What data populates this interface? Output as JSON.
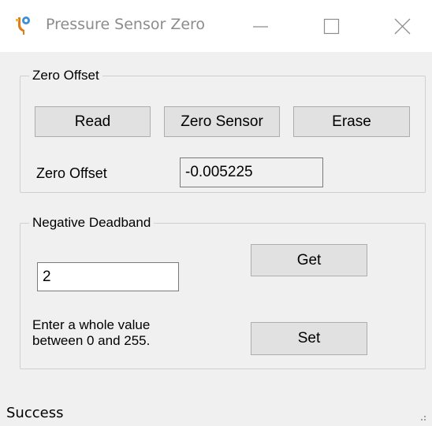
{
  "window": {
    "title": "Pressure Sensor Zero",
    "icon": "pressure-gauge-icon",
    "controls": [
      "minimize-icon",
      "maximize-icon",
      "close-icon"
    ]
  },
  "zero_offset_group": {
    "title": "Zero Offset",
    "read_label": "Read",
    "zero_sensor_label": "Zero Sensor",
    "erase_label": "Erase",
    "offset_label": "Zero Offset",
    "offset_value": "-0.005225"
  },
  "deadband_group": {
    "title": "Negative Deadband",
    "value": "2",
    "get_label": "Get",
    "set_label": "Set",
    "hint_line1": "Enter a whole value",
    "hint_line2": "between 0 and 255."
  },
  "status": {
    "text": "Success"
  }
}
